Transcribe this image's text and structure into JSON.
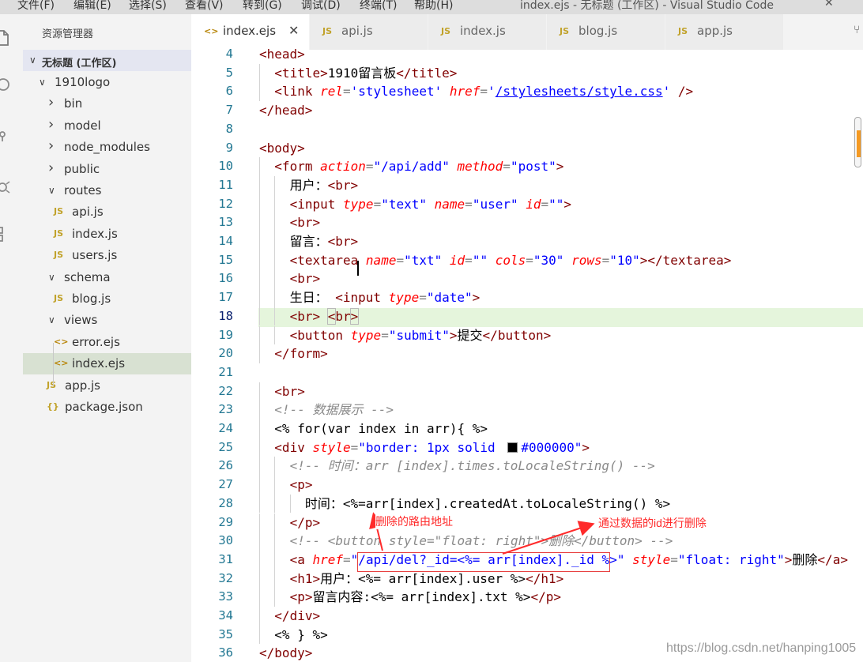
{
  "titlebar": {
    "menus": [
      "文件(F)",
      "编辑(E)",
      "选择(S)",
      "查看(V)",
      "转到(G)",
      "调试(D)",
      "终端(T)",
      "帮助(H)"
    ],
    "window_title": "index.ejs - 无标题 (工作区) - Visual Studio Code",
    "close": "✕"
  },
  "activity_icons": [
    "files-icon",
    "search-icon",
    "source-control-icon",
    "debug-icon",
    "extensions-icon"
  ],
  "sidebar": {
    "title": "资源管理器",
    "workspace": "无标题 (工作区)",
    "tree": [
      {
        "label": "1910logo",
        "type": "folder",
        "open": true,
        "depth": 1
      },
      {
        "label": "bin",
        "type": "folder",
        "open": false,
        "depth": 2
      },
      {
        "label": "model",
        "type": "folder",
        "open": false,
        "depth": 2
      },
      {
        "label": "node_modules",
        "type": "folder",
        "open": false,
        "depth": 2
      },
      {
        "label": "public",
        "type": "folder",
        "open": false,
        "depth": 2
      },
      {
        "label": "routes",
        "type": "folder",
        "open": true,
        "depth": 2
      },
      {
        "label": "api.js",
        "type": "js",
        "depth": 3
      },
      {
        "label": "index.js",
        "type": "js",
        "depth": 3
      },
      {
        "label": "users.js",
        "type": "js",
        "depth": 3
      },
      {
        "label": "schema",
        "type": "folder",
        "open": true,
        "depth": 2
      },
      {
        "label": "blog.js",
        "type": "js",
        "depth": 3
      },
      {
        "label": "views",
        "type": "folder",
        "open": true,
        "depth": 2
      },
      {
        "label": "error.ejs",
        "type": "ejs",
        "depth": 3
      },
      {
        "label": "index.ejs",
        "type": "ejs",
        "depth": 3,
        "current": true
      },
      {
        "label": "app.js",
        "type": "js",
        "depth": 2
      },
      {
        "label": "package.json",
        "type": "json",
        "depth": 2
      }
    ],
    "icon_glyphs": {
      "js": "JS",
      "ejs": "<>",
      "json": "{}"
    }
  },
  "tabs": [
    {
      "label": "index.ejs",
      "icon": "<>",
      "active": true,
      "close": "✕"
    },
    {
      "label": "api.js",
      "icon": "JS"
    },
    {
      "label": "index.js",
      "icon": "JS"
    },
    {
      "label": "blog.js",
      "icon": "JS"
    },
    {
      "label": "app.js",
      "icon": "JS"
    }
  ],
  "editor": {
    "current_line": 18,
    "lines": [
      {
        "n": 4,
        "i": 0,
        "s": [
          [
            "t",
            "<head>"
          ]
        ]
      },
      {
        "n": 5,
        "i": 1,
        "s": [
          [
            "t",
            "<title>"
          ],
          [
            "tx",
            "1910留言板"
          ],
          [
            "t",
            "</title>"
          ]
        ]
      },
      {
        "n": 6,
        "i": 1,
        "s": [
          [
            "t",
            "<link "
          ],
          [
            "ar",
            "rel"
          ],
          [
            "p",
            "="
          ],
          [
            "av",
            "'stylesheet'"
          ],
          [
            "tx",
            " "
          ],
          [
            "ar",
            "href"
          ],
          [
            "p",
            "="
          ],
          [
            "av",
            "'"
          ],
          [
            "avu",
            "/stylesheets/style.css"
          ],
          [
            "av",
            "'"
          ],
          [
            "t",
            " />"
          ]
        ]
      },
      {
        "n": 7,
        "i": 0,
        "s": [
          [
            "t",
            "</head>"
          ]
        ]
      },
      {
        "n": 8,
        "i": 0,
        "s": []
      },
      {
        "n": 9,
        "i": 0,
        "s": [
          [
            "t",
            "<body>"
          ]
        ]
      },
      {
        "n": 10,
        "i": 1,
        "s": [
          [
            "t",
            "<form "
          ],
          [
            "ar",
            "action"
          ],
          [
            "p",
            "="
          ],
          [
            "av",
            "\"/api/add\""
          ],
          [
            "tx",
            " "
          ],
          [
            "ar",
            "method"
          ],
          [
            "p",
            "="
          ],
          [
            "av",
            "\"post\""
          ],
          [
            "t",
            ">"
          ]
        ]
      },
      {
        "n": 11,
        "i": 2,
        "s": [
          [
            "tx",
            "用户："
          ],
          [
            "t",
            "<br>"
          ]
        ]
      },
      {
        "n": 12,
        "i": 2,
        "s": [
          [
            "t",
            "<input "
          ],
          [
            "ar",
            "type"
          ],
          [
            "p",
            "="
          ],
          [
            "av",
            "\"text\""
          ],
          [
            "tx",
            " "
          ],
          [
            "ar",
            "name"
          ],
          [
            "p",
            "="
          ],
          [
            "av",
            "\"user\""
          ],
          [
            "tx",
            " "
          ],
          [
            "ar",
            "id"
          ],
          [
            "p",
            "="
          ],
          [
            "av",
            "\"\""
          ],
          [
            "t",
            ">"
          ]
        ]
      },
      {
        "n": 13,
        "i": 2,
        "s": [
          [
            "t",
            "<br>"
          ]
        ]
      },
      {
        "n": 14,
        "i": 2,
        "s": [
          [
            "tx",
            "留言："
          ],
          [
            "t",
            "<br>"
          ]
        ]
      },
      {
        "n": 15,
        "i": 2,
        "s": [
          [
            "t",
            "<textarea "
          ],
          [
            "ar",
            "name"
          ],
          [
            "p",
            "="
          ],
          [
            "av",
            "\"txt\""
          ],
          [
            "tx",
            " "
          ],
          [
            "ar",
            "id"
          ],
          [
            "p",
            "="
          ],
          [
            "av",
            "\"\""
          ],
          [
            "tx",
            " "
          ],
          [
            "ar",
            "cols"
          ],
          [
            "p",
            "="
          ],
          [
            "av",
            "\"30\""
          ],
          [
            "tx",
            " "
          ],
          [
            "ar",
            "rows"
          ],
          [
            "p",
            "="
          ],
          [
            "av",
            "\"10\""
          ],
          [
            "t",
            "></textarea>"
          ]
        ]
      },
      {
        "n": 16,
        "i": 2,
        "s": [
          [
            "t",
            "<br>"
          ]
        ]
      },
      {
        "n": 17,
        "i": 2,
        "s": [
          [
            "tx",
            "生日： "
          ],
          [
            "t",
            "<input "
          ],
          [
            "ar",
            "type"
          ],
          [
            "p",
            "="
          ],
          [
            "av",
            "\"date\""
          ],
          [
            "t",
            ">"
          ]
        ]
      },
      {
        "n": 18,
        "i": 2,
        "s": [
          [
            "t",
            "<br>"
          ],
          [
            "tx",
            " "
          ],
          [
            "tbm",
            "<"
          ],
          [
            "t",
            "br"
          ],
          [
            "tbm",
            ">"
          ]
        ]
      },
      {
        "n": 19,
        "i": 2,
        "s": [
          [
            "t",
            "<button "
          ],
          [
            "ar",
            "type"
          ],
          [
            "p",
            "="
          ],
          [
            "av",
            "\"submit\""
          ],
          [
            "t",
            ">"
          ],
          [
            "tx",
            "提交"
          ],
          [
            "t",
            "</button>"
          ]
        ]
      },
      {
        "n": 20,
        "i": 1,
        "s": [
          [
            "t",
            "</form>"
          ]
        ]
      },
      {
        "n": 21,
        "i": 0,
        "s": []
      },
      {
        "n": 22,
        "i": 1,
        "s": [
          [
            "t",
            "<br>"
          ]
        ]
      },
      {
        "n": 23,
        "i": 1,
        "s": [
          [
            "cmg",
            "<!-- 数据展示 -->"
          ]
        ]
      },
      {
        "n": 24,
        "i": 1,
        "s": [
          [
            "tx",
            "<% for(var index in arr){ %>"
          ]
        ]
      },
      {
        "n": 25,
        "i": 1,
        "s": [
          [
            "t",
            "<div "
          ],
          [
            "ar",
            "style"
          ],
          [
            "p",
            "="
          ],
          [
            "av",
            "\"border: 1px solid "
          ],
          [
            "sq",
            ""
          ],
          [
            "av",
            "#000000\""
          ],
          [
            "t",
            ">"
          ]
        ]
      },
      {
        "n": 26,
        "i": 2,
        "s": [
          [
            "cmg",
            "<!-- 时间：arr [index].times.toLocaleString() -->"
          ]
        ]
      },
      {
        "n": 27,
        "i": 2,
        "s": [
          [
            "t",
            "<p>"
          ]
        ]
      },
      {
        "n": 28,
        "i": 3,
        "s": [
          [
            "tx",
            "时间：<%=arr[index].createdAt.toLocaleString() %>"
          ]
        ]
      },
      {
        "n": 29,
        "i": 2,
        "s": [
          [
            "t",
            "</p>"
          ]
        ]
      },
      {
        "n": 30,
        "i": 2,
        "s": [
          [
            "cmg",
            "<!-- <button style=\"float: right\">删除</button> -->"
          ]
        ]
      },
      {
        "n": 31,
        "i": 2,
        "s": [
          [
            "t",
            "<a "
          ],
          [
            "ar",
            "href"
          ],
          [
            "p",
            "="
          ],
          [
            "av",
            "\"/api/del?_id=<%= arr[index]._id %>\""
          ],
          [
            "tx",
            " "
          ],
          [
            "ar",
            "style"
          ],
          [
            "p",
            "="
          ],
          [
            "av",
            "\"float: right\""
          ],
          [
            "t",
            ">"
          ],
          [
            "tx",
            "删除"
          ],
          [
            "t",
            "</a>"
          ]
        ]
      },
      {
        "n": 32,
        "i": 2,
        "s": [
          [
            "t",
            "<h1>"
          ],
          [
            "tx",
            "用户：<%= arr[index].user %>"
          ],
          [
            "t",
            "</h1>"
          ]
        ]
      },
      {
        "n": 33,
        "i": 2,
        "s": [
          [
            "t",
            "<p>"
          ],
          [
            "tx",
            "留言内容:<%= arr[index].txt %>"
          ],
          [
            "t",
            "</p>"
          ]
        ]
      },
      {
        "n": 34,
        "i": 1,
        "s": [
          [
            "t",
            "</div>"
          ]
        ]
      },
      {
        "n": 35,
        "i": 1,
        "s": [
          [
            "tx",
            "<% } %>"
          ]
        ]
      },
      {
        "n": 36,
        "i": 0,
        "s": [
          [
            "t",
            "</body>"
          ]
        ]
      }
    ]
  },
  "annotations": {
    "route_note": "删除的路由地址",
    "id_note": "通过数据的id进行删除"
  },
  "watermark": "https://blog.csdn.net/hanping1005"
}
